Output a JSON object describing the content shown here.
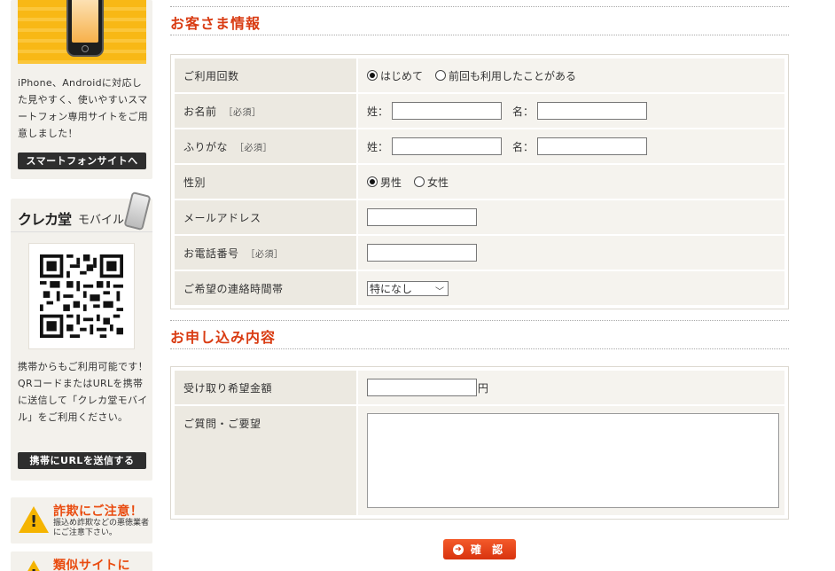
{
  "sidebar": {
    "smartphone": {
      "text": "iPhone、Androidに対応した見やすく、使いやすいスマートフォン専用サイトをご用意しました！",
      "button": "スマートフォンサイトへ"
    },
    "mobile": {
      "logo": "クレカ堂",
      "logo_sub": "モバイル",
      "text": "携帯からもご利用可能です！QRコードまたはURLを携帯に送信して「クレカ堂モバイル」をご利用ください。",
      "button": "携帯にURLを送信する"
    },
    "warning1": {
      "title": "詐欺にご注意！",
      "sub": "振込め詐欺などの悪徳業者にご注意下さい。"
    },
    "warning2": {
      "title": "類似サイトに"
    }
  },
  "customer": {
    "heading": "お客さま情報",
    "usage": {
      "label": "ご利用回数",
      "options": [
        "はじめて",
        "前回も利用したことがある"
      ],
      "selected": 0
    },
    "name": {
      "label": "お名前",
      "req": "［必須］",
      "sei": "姓：",
      "mei": "名："
    },
    "furigana": {
      "label": "ふりがな",
      "req": "［必須］",
      "sei": "姓：",
      "mei": "名："
    },
    "gender": {
      "label": "性別",
      "options": [
        "男性",
        "女性"
      ],
      "selected": 0
    },
    "email": {
      "label": "メールアドレス"
    },
    "phone": {
      "label": "お電話番号",
      "req": "［必須］"
    },
    "contact_time": {
      "label": "ご希望の連絡時間帯",
      "value": "特になし"
    }
  },
  "application": {
    "heading": "お申し込み内容",
    "amount": {
      "label": "受け取り希望金額",
      "unit": "円"
    },
    "questions": {
      "label": "ご質問・ご要望"
    }
  },
  "confirm_button": "確 認"
}
